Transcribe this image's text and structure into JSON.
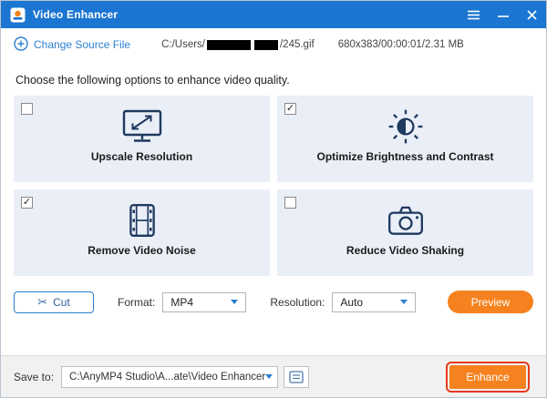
{
  "titlebar": {
    "title": "Video Enhancer"
  },
  "source_bar": {
    "change_source_label": "Change Source File",
    "path_prefix": "C:/Users/",
    "path_suffix": "/245.gif",
    "file_info": "680x383/00:00:01/2.31 MB"
  },
  "instruction": "Choose the following options to enhance video quality.",
  "options": [
    {
      "label": "Upscale Resolution",
      "checked": false,
      "icon": "monitor-upscale-icon"
    },
    {
      "label": "Optimize Brightness and Contrast",
      "checked": true,
      "icon": "sun-brightness-icon"
    },
    {
      "label": "Remove Video Noise",
      "checked": true,
      "icon": "filmstrip-icon"
    },
    {
      "label": "Reduce Video Shaking",
      "checked": false,
      "icon": "camera-icon"
    }
  ],
  "controls": {
    "cut_label": "Cut",
    "format_label": "Format:",
    "format_value": "MP4",
    "resolution_label": "Resolution:",
    "resolution_value": "Auto",
    "preview_label": "Preview"
  },
  "footer": {
    "save_label": "Save to:",
    "save_path": "C:\\AnyMP4 Studio\\A...ate\\Video Enhancer",
    "enhance_label": "Enhance"
  },
  "colors": {
    "titlebar_blue": "#1b76d2",
    "accent_blue": "#2a7fd0",
    "accent_orange": "#f5821f",
    "highlight_red": "#e8391d",
    "icon_navy": "#1f3a5f"
  }
}
